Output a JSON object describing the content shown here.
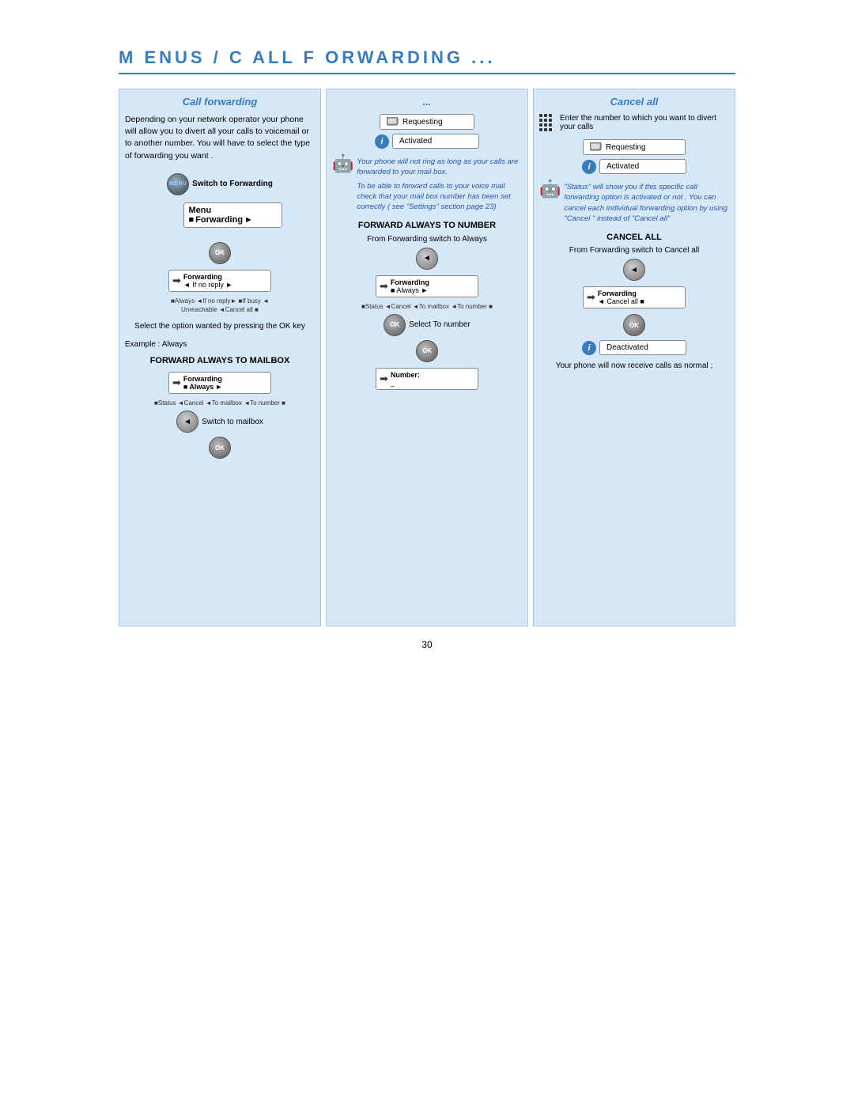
{
  "page": {
    "title": "M ENUS  /  C ALL   F ORWARDING ...",
    "page_number": "30"
  },
  "col1": {
    "title": "Call forwarding",
    "intro": "Depending on your network operator your phone will allow you to divert all your calls to voicemail or to another number. You will have to select the type of forwarding you want .",
    "step1_label": "Switch to Forwarding",
    "menu_label": "Menu",
    "fw1_label": "Forwarding",
    "fw1_sub": "◄ If no reply ►",
    "options_line1": "■Always  ◄If no reply►  ■If busy  ◄",
    "options_line2": "Unreachable  ◄Cancel all  ■",
    "select_text": "Select the option wanted by pressing the OK key",
    "example_label": "Example : Always",
    "forward_always": "FORWARD ALWAYS TO MAILBOX",
    "fw2_label": "Forwarding",
    "fw2_sub_left": "■",
    "fw2_sub_mid": "Always",
    "fw2_sub_right": "►",
    "status_line": "■Status  ◄Cancel  ◄To mailbox  ◄To number ■",
    "switch_mailbox": "Switch to mailbox"
  },
  "col2": {
    "title": "...",
    "requesting_label": "Requesting",
    "activated_label": "Activated",
    "italic_text1": "Your phone will not ring as long as your calls are forwarded to your mail box.",
    "italic_text2": "To be able to forward calls to your voice mail check that your mail box number has been set correctly ( see \"Settings\" section page 23)",
    "forward_always_number": "FORWARD ALWAYS TO NUMBER",
    "from_fw_switch": "From Forwarding switch to Always",
    "fw3_label": "Forwarding",
    "fw3_sub": "■ Always ►",
    "status_line2": "■Status  ◄Cancel  ◄To mailbox  ◄To number ■",
    "select_to_number": "Select To number",
    "number_label": "Number:",
    "number_cursor": "_"
  },
  "col3": {
    "title": "Cancel all",
    "enter_text": "Enter the number to which you want to divert your calls",
    "requesting_label": "Requesting",
    "activated_label": "Activated",
    "italic_text": "\"Status\" will show you if this specific call forwarding option is activated or not . You can cancel each individual forwarding option by using \"Cancel \" instead of \"Cancel all\"",
    "cancel_all_header": "CANCEL ALL",
    "from_fw_cancel": "From Forwarding switch to Cancel all",
    "fw4_label": "Forwarding",
    "fw4_sub": "◄ Cancel all ■",
    "deactivated_label": "Deactivated",
    "footer_text": "Your phone will now receive calls as normal ;"
  }
}
